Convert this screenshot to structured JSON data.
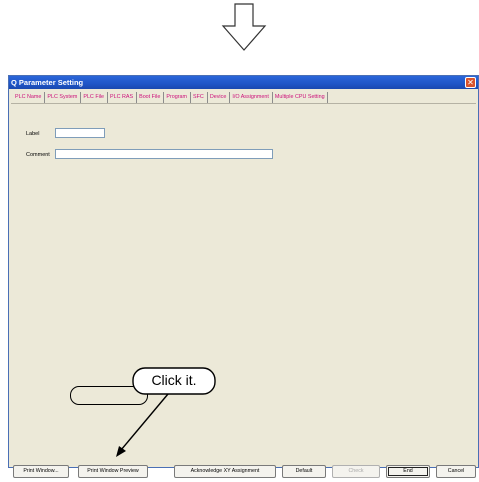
{
  "window": {
    "title": "Q Parameter Setting"
  },
  "tabs": [
    "PLC Name",
    "PLC System",
    "PLC File",
    "PLC RAS",
    "Boot File",
    "Program",
    "SFC",
    "Device",
    "I/O Assignment",
    "Multiple CPU Setting"
  ],
  "form": {
    "label_label": "Label",
    "label_value": "",
    "comment_label": "Comment",
    "comment_value": ""
  },
  "buttons": {
    "print_window": "Print Window...",
    "print_window_preview": "Print Window Preview",
    "acknowledge_xy": "Acknowledge XY Assignment",
    "default": "Default",
    "check": "Check",
    "end": "End",
    "cancel": "Cancel"
  },
  "callout": {
    "text": "Click it."
  },
  "colors": {
    "tab_text": "#cc0f7a",
    "titlebar": "#1f55c7",
    "window_bg": "#ece9d8"
  }
}
